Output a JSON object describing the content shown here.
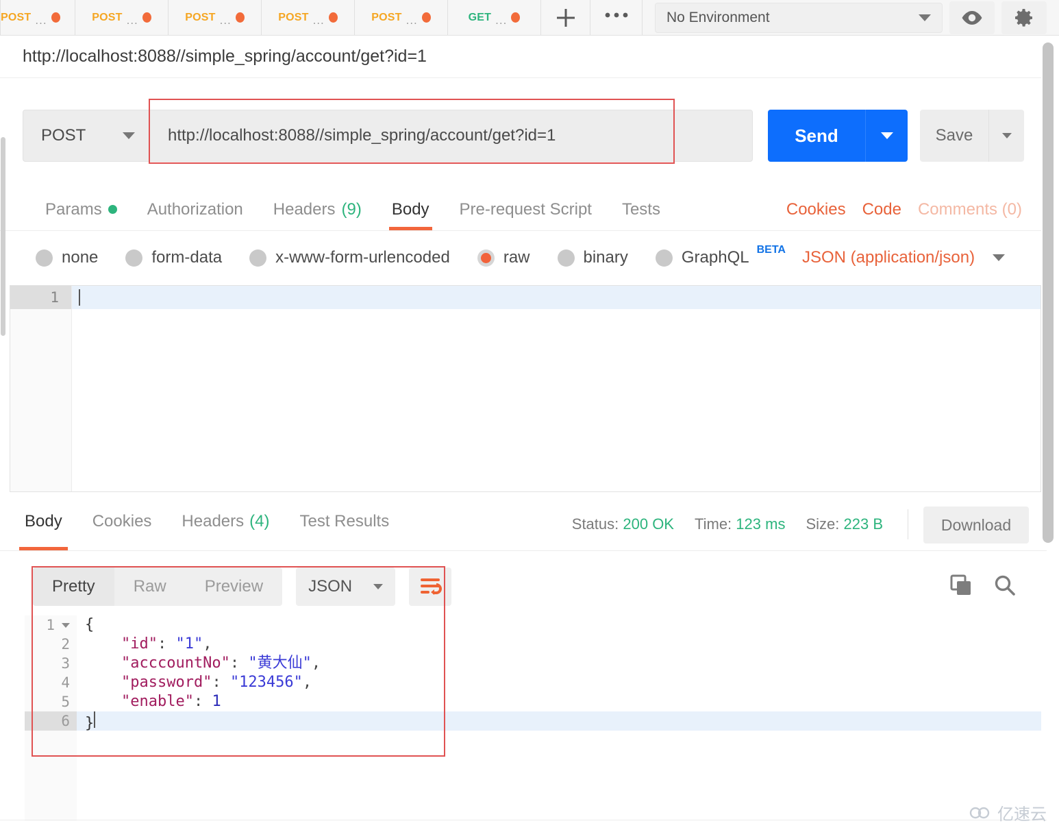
{
  "tabbar": {
    "tabs": [
      {
        "method": "POST",
        "name": "...",
        "dirty": true
      },
      {
        "method": "POST",
        "name": "...",
        "dirty": true
      },
      {
        "method": "POST",
        "name": "...",
        "dirty": true
      },
      {
        "method": "POST",
        "name": "...",
        "dirty": true
      },
      {
        "method": "POST",
        "name": "...",
        "dirty": true
      },
      {
        "method": "GET",
        "name": "...",
        "dirty": true
      }
    ],
    "new_tab_icon": "plus-icon",
    "more_tabs_icon": "ellipsis-icon",
    "environment": {
      "selected": "No Environment",
      "dropdown_icon": "chevron-down-icon"
    },
    "eye_icon": "eye-icon",
    "settings_icon": "gear-icon"
  },
  "request": {
    "title": "http://localhost:8088//simple_spring/account/get?id=1",
    "method": "POST",
    "url": "http://localhost:8088//simple_spring/account/get?id=1",
    "send_label": "Send",
    "save_label": "Save",
    "tabs": [
      {
        "label": "Params",
        "badge": "",
        "dot": true,
        "active": false
      },
      {
        "label": "Authorization",
        "badge": "",
        "dot": false,
        "active": false
      },
      {
        "label": "Headers",
        "badge": "(9)",
        "dot": false,
        "active": false
      },
      {
        "label": "Body",
        "badge": "",
        "dot": false,
        "active": true
      },
      {
        "label": "Pre-request Script",
        "badge": "",
        "dot": false,
        "active": false
      },
      {
        "label": "Tests",
        "badge": "",
        "dot": false,
        "active": false
      }
    ],
    "links": [
      {
        "label": "Cookies",
        "dim": false
      },
      {
        "label": "Code",
        "dim": false
      },
      {
        "label": "Comments (0)",
        "dim": true
      }
    ],
    "body_modes": [
      {
        "label": "none",
        "selected": false
      },
      {
        "label": "form-data",
        "selected": false
      },
      {
        "label": "x-www-form-urlencoded",
        "selected": false
      },
      {
        "label": "raw",
        "selected": true
      },
      {
        "label": "binary",
        "selected": false
      },
      {
        "label": "GraphQL",
        "selected": false,
        "superscript": "BETA"
      }
    ],
    "content_type": "JSON (application/json)",
    "editor": {
      "lines": [
        {
          "no": "1",
          "text": ""
        }
      ]
    }
  },
  "response": {
    "tabs": [
      {
        "label": "Body",
        "badge": "",
        "active": true
      },
      {
        "label": "Cookies",
        "badge": "",
        "active": false
      },
      {
        "label": "Headers",
        "badge": "(4)",
        "active": false
      },
      {
        "label": "Test Results",
        "badge": "",
        "active": false
      }
    ],
    "meta": {
      "status_label": "Status:",
      "status_value": "200 OK",
      "time_label": "Time:",
      "time_value": "123 ms",
      "size_label": "Size:",
      "size_value": "223 B"
    },
    "download_label": "Download",
    "view_modes": [
      {
        "label": "Pretty",
        "active": true
      },
      {
        "label": "Raw",
        "active": false
      },
      {
        "label": "Preview",
        "active": false
      }
    ],
    "format": "JSON",
    "wrap_icon": "word-wrap-icon",
    "copy_icon": "copy-icon",
    "search_icon": "search-icon",
    "code_lines": [
      {
        "no": "1",
        "foldable": true,
        "active": false,
        "tokens": [
          {
            "t": "{",
            "c": "brace"
          }
        ]
      },
      {
        "no": "2",
        "foldable": false,
        "active": false,
        "tokens": [
          {
            "t": "    \"id\"",
            "c": "k"
          },
          {
            "t": ": ",
            "c": "p"
          },
          {
            "t": "\"1\"",
            "c": "s"
          },
          {
            "t": ",",
            "c": "p"
          }
        ]
      },
      {
        "no": "3",
        "foldable": false,
        "active": false,
        "tokens": [
          {
            "t": "    \"acccountNo\"",
            "c": "k"
          },
          {
            "t": ": ",
            "c": "p"
          },
          {
            "t": "\"黄大仙\"",
            "c": "s"
          },
          {
            "t": ",",
            "c": "p"
          }
        ]
      },
      {
        "no": "4",
        "foldable": false,
        "active": false,
        "tokens": [
          {
            "t": "    \"password\"",
            "c": "k"
          },
          {
            "t": ": ",
            "c": "p"
          },
          {
            "t": "\"123456\"",
            "c": "s"
          },
          {
            "t": ",",
            "c": "p"
          }
        ]
      },
      {
        "no": "5",
        "foldable": false,
        "active": false,
        "tokens": [
          {
            "t": "    \"enable\"",
            "c": "k"
          },
          {
            "t": ": ",
            "c": "p"
          },
          {
            "t": "1",
            "c": "n"
          }
        ]
      },
      {
        "no": "6",
        "foldable": false,
        "active": true,
        "tokens": [
          {
            "t": "}",
            "c": "brace"
          }
        ]
      }
    ],
    "parsed_json": {
      "id": "1",
      "acccountNo": "黄大仙",
      "password": "123456",
      "enable": 1
    }
  },
  "watermark": {
    "text": "亿速云",
    "icon": "cloud-logo-icon"
  },
  "colors": {
    "accent_orange": "#f2663c",
    "send_blue": "#0d6efd",
    "status_green": "#2db47d",
    "method_post": "#f5a623",
    "method_get": "#2db47d",
    "annotation_red": "#e05252"
  }
}
